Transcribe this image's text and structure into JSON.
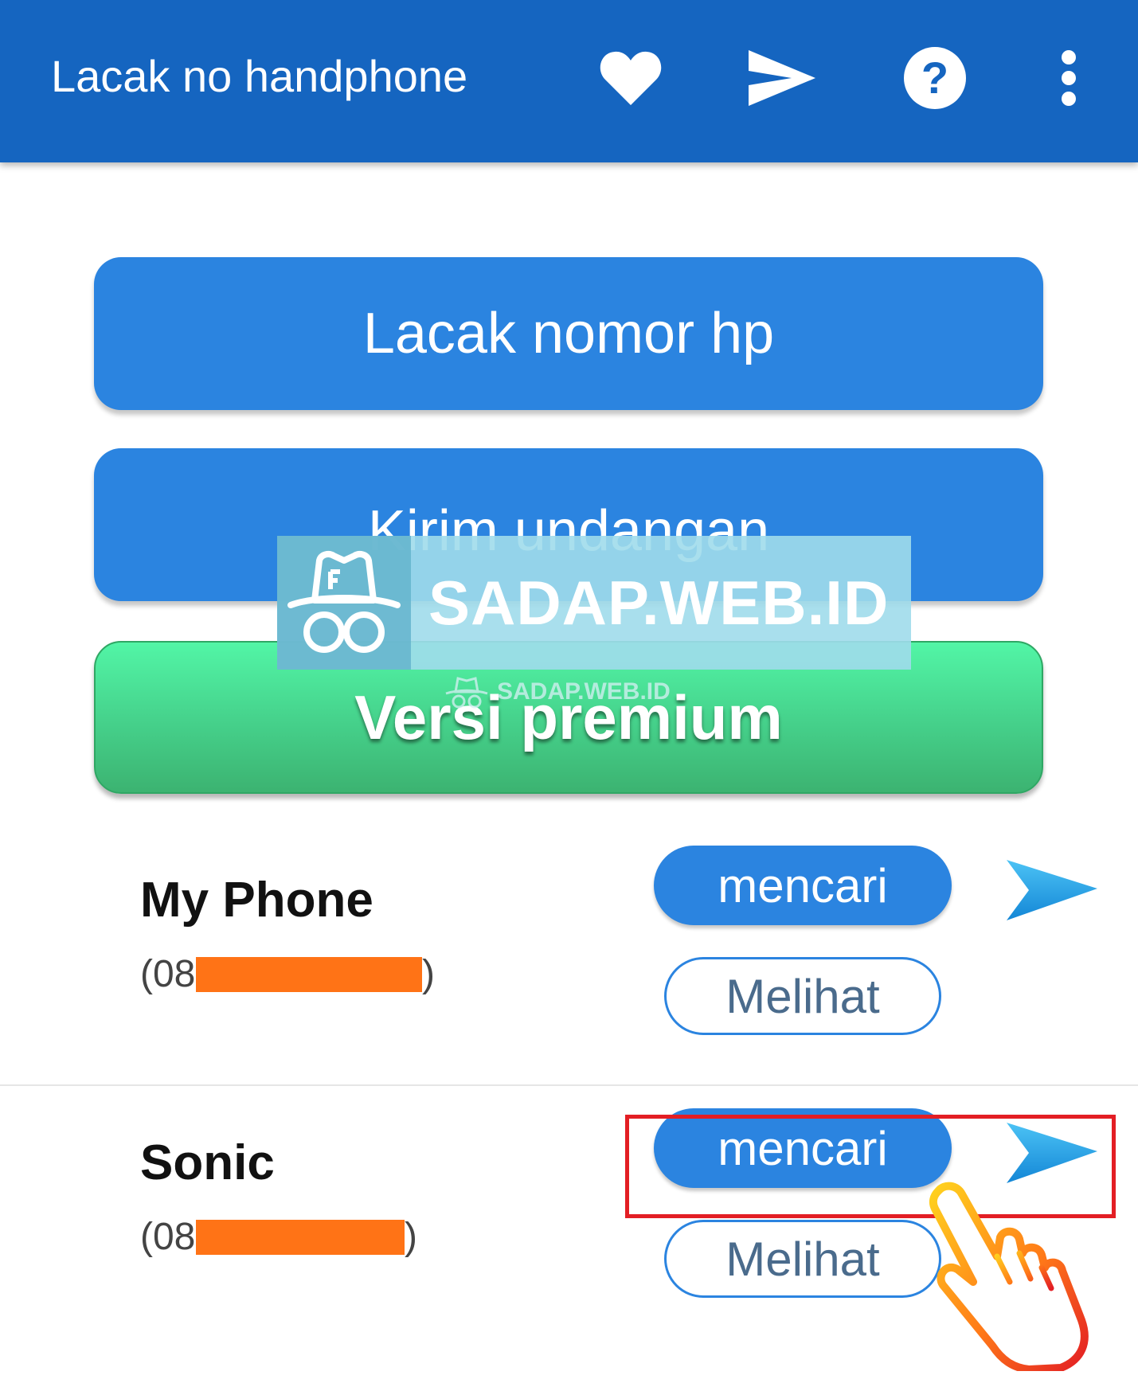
{
  "appbar": {
    "title": "Lacak no handphone",
    "icons": [
      "heart-icon",
      "send-icon",
      "help-icon",
      "more-vert-icon"
    ]
  },
  "actions": {
    "track": "Lacak nomor hp",
    "invite": "Kirim undangan",
    "premium": "Versi premium"
  },
  "watermark": {
    "text": "SADAP.WEB.ID",
    "small_text": "SADAP.WEB.ID"
  },
  "contacts": [
    {
      "name": "My Phone",
      "number_prefix": "(08",
      "number_suffix": ")",
      "search_label": "mencari",
      "view_label": "Melihat"
    },
    {
      "name": "Sonic",
      "number_prefix": "(08",
      "number_suffix": ")",
      "search_label": "mencari",
      "view_label": "Melihat"
    }
  ],
  "colors": {
    "appbar": "#1565c0",
    "button_blue": "#2b84e0",
    "premium_green": "#45d08a",
    "redaction": "#ff7316",
    "highlight": "#e31e24",
    "send_arrow": "#1e9be6"
  }
}
